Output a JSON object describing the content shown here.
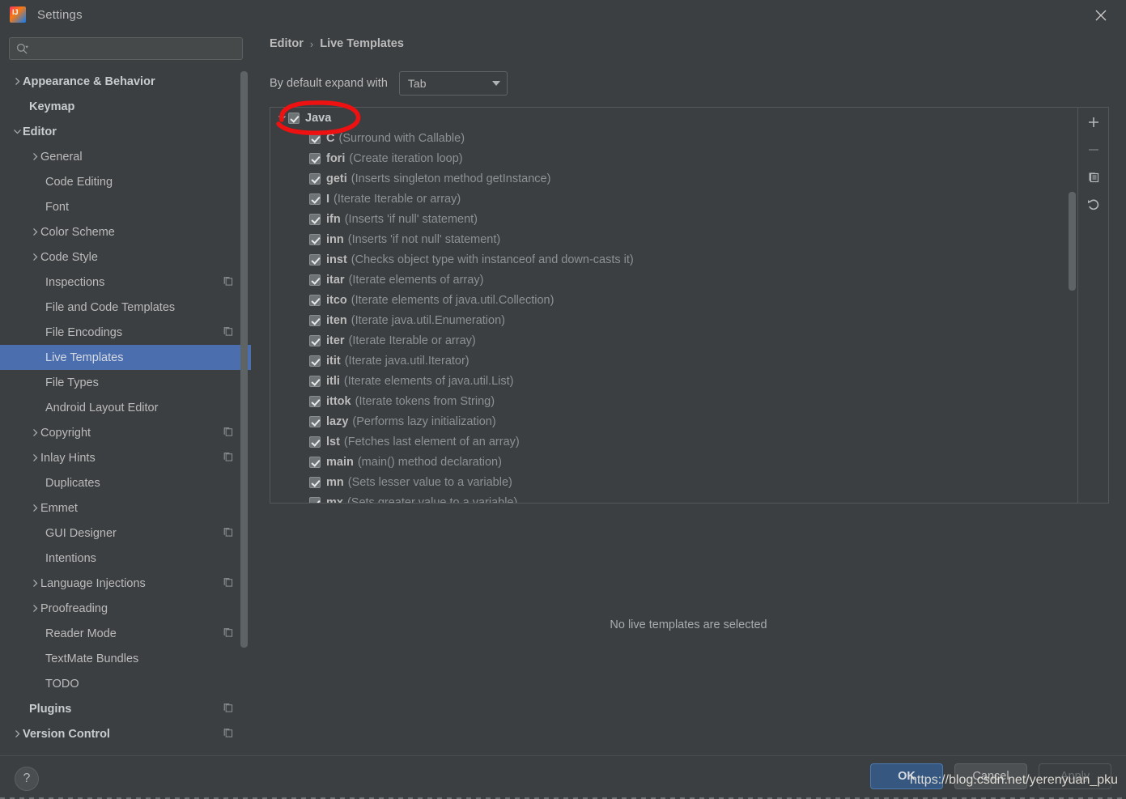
{
  "window": {
    "title": "Settings",
    "app_icon": "intellij-idea-logo",
    "close_icon": "close-icon"
  },
  "search": {
    "value": "",
    "placeholder": "",
    "icon": "search-icon"
  },
  "sidebar": {
    "items": [
      {
        "label": "Appearance & Behavior",
        "level": 0,
        "arrow": "chevron-right",
        "bold": true,
        "badge": false,
        "selected": false
      },
      {
        "label": "Keymap",
        "level": 0,
        "arrow": "none",
        "bold": true,
        "badge": false,
        "selected": false
      },
      {
        "label": "Editor",
        "level": 0,
        "arrow": "chevron-down",
        "bold": true,
        "badge": false,
        "selected": false
      },
      {
        "label": "General",
        "level": 1,
        "arrow": "chevron-right",
        "bold": false,
        "badge": false,
        "selected": false
      },
      {
        "label": "Code Editing",
        "level": 1,
        "arrow": "none",
        "bold": false,
        "badge": false,
        "selected": false
      },
      {
        "label": "Font",
        "level": 1,
        "arrow": "none",
        "bold": false,
        "badge": false,
        "selected": false
      },
      {
        "label": "Color Scheme",
        "level": 1,
        "arrow": "chevron-right",
        "bold": false,
        "badge": false,
        "selected": false
      },
      {
        "label": "Code Style",
        "level": 1,
        "arrow": "chevron-right",
        "bold": false,
        "badge": false,
        "selected": false
      },
      {
        "label": "Inspections",
        "level": 1,
        "arrow": "none",
        "bold": false,
        "badge": true,
        "selected": false
      },
      {
        "label": "File and Code Templates",
        "level": 1,
        "arrow": "none",
        "bold": false,
        "badge": false,
        "selected": false
      },
      {
        "label": "File Encodings",
        "level": 1,
        "arrow": "none",
        "bold": false,
        "badge": true,
        "selected": false
      },
      {
        "label": "Live Templates",
        "level": 1,
        "arrow": "none",
        "bold": false,
        "badge": false,
        "selected": true
      },
      {
        "label": "File Types",
        "level": 1,
        "arrow": "none",
        "bold": false,
        "badge": false,
        "selected": false
      },
      {
        "label": "Android Layout Editor",
        "level": 1,
        "arrow": "none",
        "bold": false,
        "badge": false,
        "selected": false
      },
      {
        "label": "Copyright",
        "level": 1,
        "arrow": "chevron-right",
        "bold": false,
        "badge": true,
        "selected": false
      },
      {
        "label": "Inlay Hints",
        "level": 1,
        "arrow": "chevron-right",
        "bold": false,
        "badge": true,
        "selected": false
      },
      {
        "label": "Duplicates",
        "level": 1,
        "arrow": "none",
        "bold": false,
        "badge": false,
        "selected": false
      },
      {
        "label": "Emmet",
        "level": 1,
        "arrow": "chevron-right",
        "bold": false,
        "badge": false,
        "selected": false
      },
      {
        "label": "GUI Designer",
        "level": 1,
        "arrow": "none",
        "bold": false,
        "badge": true,
        "selected": false
      },
      {
        "label": "Intentions",
        "level": 1,
        "arrow": "none",
        "bold": false,
        "badge": false,
        "selected": false
      },
      {
        "label": "Language Injections",
        "level": 1,
        "arrow": "chevron-right",
        "bold": false,
        "badge": true,
        "selected": false
      },
      {
        "label": "Proofreading",
        "level": 1,
        "arrow": "chevron-right",
        "bold": false,
        "badge": false,
        "selected": false
      },
      {
        "label": "Reader Mode",
        "level": 1,
        "arrow": "none",
        "bold": false,
        "badge": true,
        "selected": false
      },
      {
        "label": "TextMate Bundles",
        "level": 1,
        "arrow": "none",
        "bold": false,
        "badge": false,
        "selected": false
      },
      {
        "label": "TODO",
        "level": 1,
        "arrow": "none",
        "bold": false,
        "badge": false,
        "selected": false
      },
      {
        "label": "Plugins",
        "level": 0,
        "arrow": "none",
        "bold": true,
        "badge": true,
        "selected": false
      },
      {
        "label": "Version Control",
        "level": 0,
        "arrow": "chevron-right",
        "bold": true,
        "badge": true,
        "selected": false
      }
    ]
  },
  "main": {
    "breadcrumb": {
      "parent": "Editor",
      "separator": "›",
      "current": "Live Templates"
    },
    "expand_with": {
      "label": "By default expand with",
      "value": "Tab",
      "caret_icon": "chevron-down-icon"
    },
    "toolbar": [
      {
        "name": "add-template-button",
        "icon": "plus-icon",
        "enabled": true
      },
      {
        "name": "remove-template-button",
        "icon": "minus-icon",
        "enabled": false
      },
      {
        "name": "duplicate-template-button",
        "icon": "copy-icon",
        "enabled": true
      },
      {
        "name": "restore-defaults-button",
        "icon": "revert-icon",
        "enabled": true
      }
    ],
    "empty_message": "No live templates are selected",
    "templates": [
      {
        "group": true,
        "checked": true,
        "abbr": "Java",
        "desc": "",
        "arrow": "chevron-down"
      },
      {
        "group": false,
        "checked": true,
        "abbr": "C",
        "desc": "(Surround with Callable)"
      },
      {
        "group": false,
        "checked": true,
        "abbr": "fori",
        "desc": "(Create iteration loop)"
      },
      {
        "group": false,
        "checked": true,
        "abbr": "geti",
        "desc": "(Inserts singleton method getInstance)"
      },
      {
        "group": false,
        "checked": true,
        "abbr": "I",
        "desc": "(Iterate Iterable or array)"
      },
      {
        "group": false,
        "checked": true,
        "abbr": "ifn",
        "desc": "(Inserts 'if null' statement)"
      },
      {
        "group": false,
        "checked": true,
        "abbr": "inn",
        "desc": "(Inserts 'if not null' statement)"
      },
      {
        "group": false,
        "checked": true,
        "abbr": "inst",
        "desc": "(Checks object type with instanceof and down-casts it)"
      },
      {
        "group": false,
        "checked": true,
        "abbr": "itar",
        "desc": "(Iterate elements of array)"
      },
      {
        "group": false,
        "checked": true,
        "abbr": "itco",
        "desc": "(Iterate elements of java.util.Collection)"
      },
      {
        "group": false,
        "checked": true,
        "abbr": "iten",
        "desc": "(Iterate java.util.Enumeration)"
      },
      {
        "group": false,
        "checked": true,
        "abbr": "iter",
        "desc": "(Iterate Iterable or array)"
      },
      {
        "group": false,
        "checked": true,
        "abbr": "itit",
        "desc": "(Iterate java.util.Iterator)"
      },
      {
        "group": false,
        "checked": true,
        "abbr": "itli",
        "desc": "(Iterate elements of java.util.List)"
      },
      {
        "group": false,
        "checked": true,
        "abbr": "ittok",
        "desc": "(Iterate tokens from String)"
      },
      {
        "group": false,
        "checked": true,
        "abbr": "lazy",
        "desc": "(Performs lazy initialization)"
      },
      {
        "group": false,
        "checked": true,
        "abbr": "lst",
        "desc": "(Fetches last element of an array)"
      },
      {
        "group": false,
        "checked": true,
        "abbr": "main",
        "desc": "(main() method declaration)"
      },
      {
        "group": false,
        "checked": true,
        "abbr": "mn",
        "desc": "(Sets lesser value to a variable)"
      },
      {
        "group": false,
        "checked": true,
        "abbr": "mx",
        "desc": "(Sets greater value to a variable)"
      }
    ]
  },
  "footer": {
    "help_label": "?",
    "ok_label": "OK",
    "cancel_label": "Cancel",
    "apply_label": "Apply"
  },
  "overlay": {
    "watermark": "https://blog.csdn.net/yerenyuan_pku",
    "annotation_color": "#ee1111"
  },
  "colors": {
    "background": "#3c3f41",
    "selection": "#4b6eaf",
    "primary_button": "#365880",
    "text": "#bbbbbb",
    "muted_text": "#8d9194"
  }
}
